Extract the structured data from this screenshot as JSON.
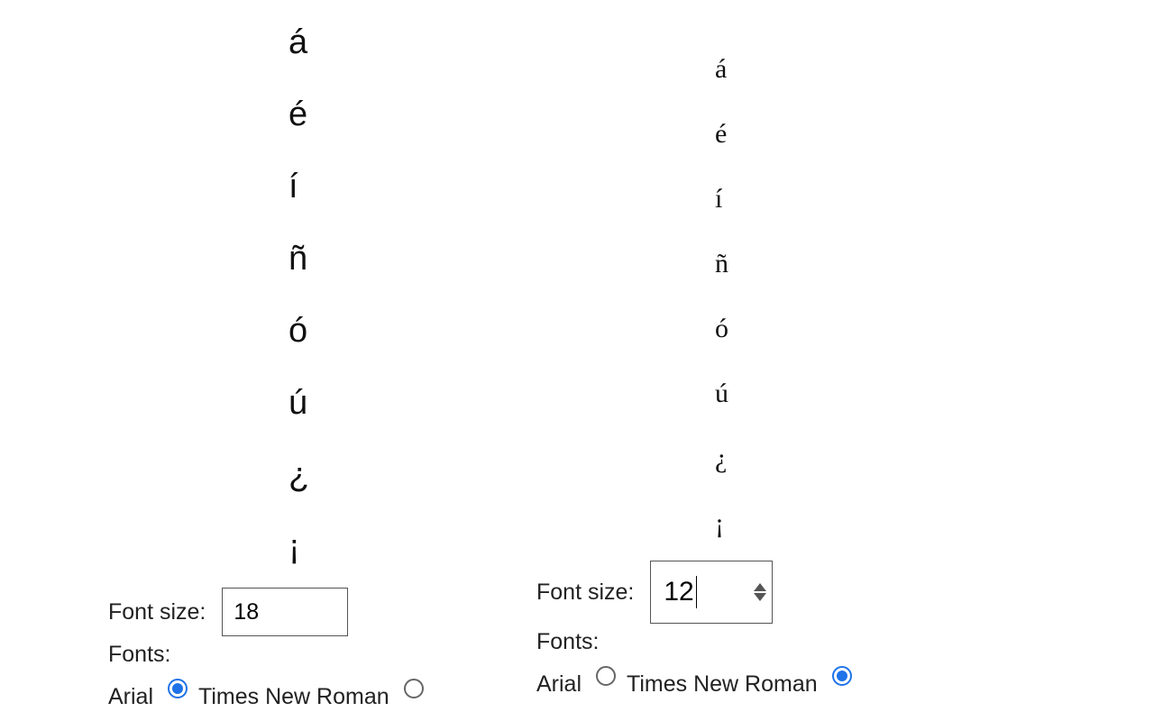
{
  "glyphs": [
    "á",
    "é",
    "í",
    "ñ",
    "ó",
    "ú",
    "¿",
    "¡"
  ],
  "left": {
    "font_size_label": "Font size:",
    "font_size_value": "18",
    "fonts_label": "Fonts:",
    "options": [
      {
        "label": "Arial",
        "checked": true
      },
      {
        "label": "Times New Roman",
        "checked": false
      }
    ]
  },
  "right": {
    "font_size_label": "Font size:",
    "font_size_value": "12",
    "fonts_label": "Fonts:",
    "options": [
      {
        "label": "Arial",
        "checked": false
      },
      {
        "label": "Times New Roman",
        "checked": true
      }
    ]
  }
}
